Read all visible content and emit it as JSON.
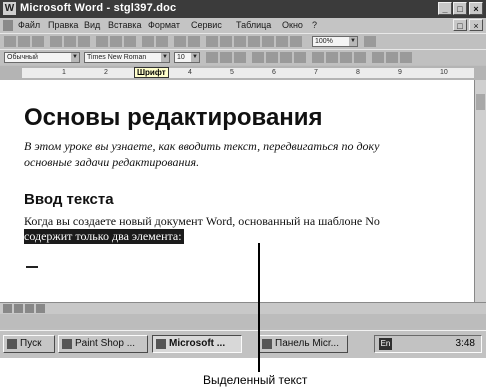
{
  "window": {
    "title": "Microsoft Word - stgl397.doc"
  },
  "menu": [
    "Файл",
    "Правка",
    "Вид",
    "Вставка",
    "Формат",
    "Сервис",
    "Таблица",
    "Окно",
    "?"
  ],
  "toolbar": {
    "zoom": "100%"
  },
  "format_bar": {
    "style": "Обычный",
    "font": "Times New Roman",
    "size": "10"
  },
  "ruler": {
    "tooltip": "Шрифт",
    "ticks": [
      "1",
      "2",
      "3",
      "4",
      "5",
      "6",
      "7",
      "8",
      "9",
      "10"
    ]
  },
  "document": {
    "heading": "Основы редактирования",
    "lead_line1": "В этом уроке вы узнаете, как вводить текст, передвигаться по доку",
    "lead_line2": "основные задачи редактирования.",
    "subheading": "Ввод текста",
    "body_line1": "Когда вы создаете новый документ Word, основанный на шаблоне No",
    "selected_text": "содержит только два элемента:"
  },
  "taskbar": {
    "items": [
      "Пуск",
      "Paint Shop ...",
      "Microsoft ...",
      "Панель Micr..."
    ],
    "language": "En",
    "clock": "3:48"
  },
  "annotation": {
    "label": "Выделенный текст"
  },
  "colors": {
    "titlebar": "#3b3b3b",
    "selection": "#1b1b1b",
    "chrome": "#c0c0c0"
  }
}
